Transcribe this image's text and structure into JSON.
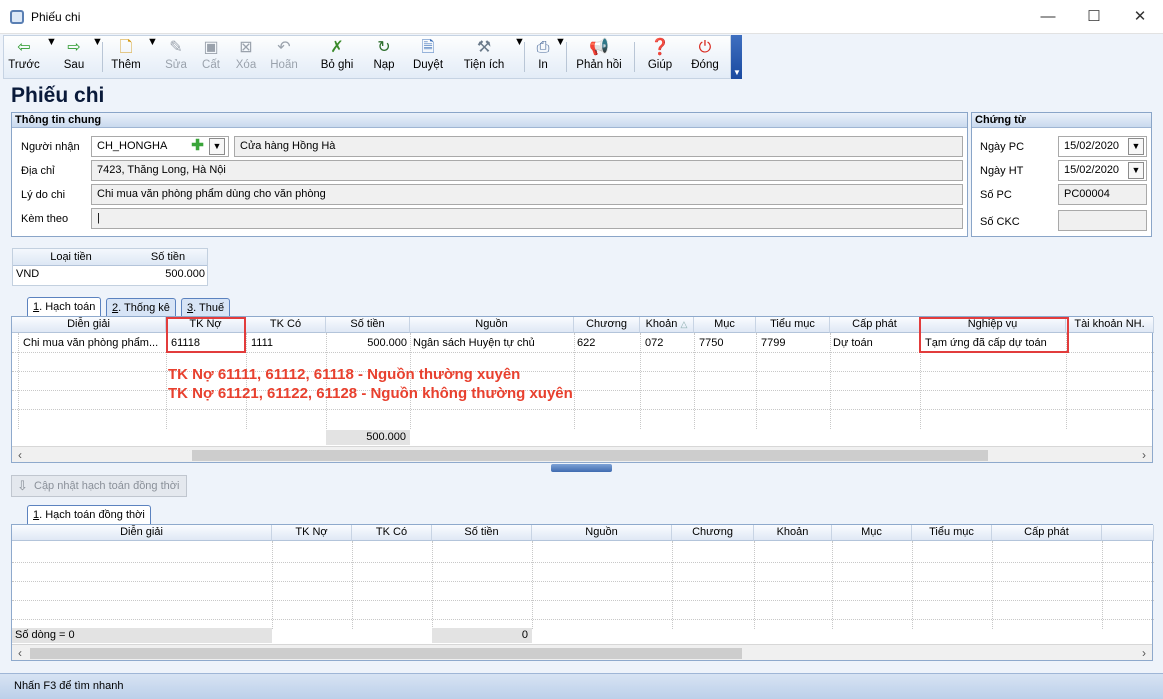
{
  "window": {
    "title": "Phiếu chi",
    "minimize": "—",
    "maximize": "☐",
    "close": "✕"
  },
  "toolbar": {
    "prev": "Trước",
    "next": "Sau",
    "add": "Thêm",
    "edit": "Sửa",
    "save": "Cất",
    "delete": "Xóa",
    "undo": "Hoãn",
    "unpost": "Bỏ ghi",
    "load": "Nạp",
    "approve": "Duyệt",
    "utilities": "Tiện ích",
    "print": "In",
    "feedback": "Phản hồi",
    "help": "Giúp",
    "close": "Đóng"
  },
  "page_title": "Phiếu chi",
  "general_info": {
    "header": "Thông tin chung",
    "recipient_label": "Người nhận",
    "recipient_code": "CH_HONGHA",
    "recipient_name": "Cửa hàng Hồng Hà",
    "address_label": "Địa chỉ",
    "address": "7423, Thăng Long, Hà Nội",
    "reason_label": "Lý do chi",
    "reason": "Chi mua văn phòng phẩm dùng cho văn phòng",
    "attach_label": "Kèm theo",
    "attach": "|"
  },
  "voucher": {
    "header": "Chứng từ",
    "pc_date_label": "Ngày PC",
    "pc_date": "15/02/2020",
    "ht_date_label": "Ngày HT",
    "ht_date": "15/02/2020",
    "pc_no_label": "Số PC",
    "pc_no": "PC00004",
    "ckc_no_label": "Số CKC",
    "ckc_no": ""
  },
  "currency": {
    "col_type": "Loại tiền",
    "col_amount": "Số tiền",
    "type": "VND",
    "amount": "500.000"
  },
  "tabs": [
    {
      "key": "1",
      "label": ". Hạch toán"
    },
    {
      "key": "2",
      "label": ". Thống kê"
    },
    {
      "key": "3",
      "label": ". Thuế"
    }
  ],
  "accounting_grid": {
    "headers": [
      "Diễn giải",
      "TK Nợ",
      "TK Có",
      "Số tiền",
      "Nguồn",
      "Chương",
      "Khoản",
      "Mục",
      "Tiểu mục",
      "Cấp phát",
      "Nghiệp vụ",
      "Tài khoản NH."
    ],
    "rows": [
      [
        "Chi mua văn phòng phẩm...",
        "61118",
        "1111",
        "500.000",
        "Ngân sách Huyện tự chủ",
        "622",
        "072",
        "7750",
        "7799",
        "Dự toán",
        "Tạm ứng đã cấp dự toán",
        ""
      ]
    ],
    "total": "500.000",
    "sort_icon": "△"
  },
  "annotation": {
    "line1": "TK Nợ 61111, 61112, 61118 - Nguồn thường xuyên",
    "line2": "TK Nợ 61121, 61122, 61128 - Nguồn không thường xuyên"
  },
  "update_button": "Cập nhật hạch toán đồng thời",
  "concurrent_tab": {
    "key": "1",
    "label": ". Hạch toán đồng thời"
  },
  "concurrent_grid": {
    "headers": [
      "Diễn giải",
      "TK Nợ",
      "TK Có",
      "Số tiền",
      "Nguồn",
      "Chương",
      "Khoản",
      "Mục",
      "Tiểu mục",
      "Cấp phát"
    ],
    "row_count": "Số dòng = 0",
    "total": "0"
  },
  "status": "Nhấn F3 để tìm nhanh",
  "colors": {
    "highlight": "#e23c3c",
    "annotation": "#e8402e",
    "accent": "#3f6ab0"
  }
}
